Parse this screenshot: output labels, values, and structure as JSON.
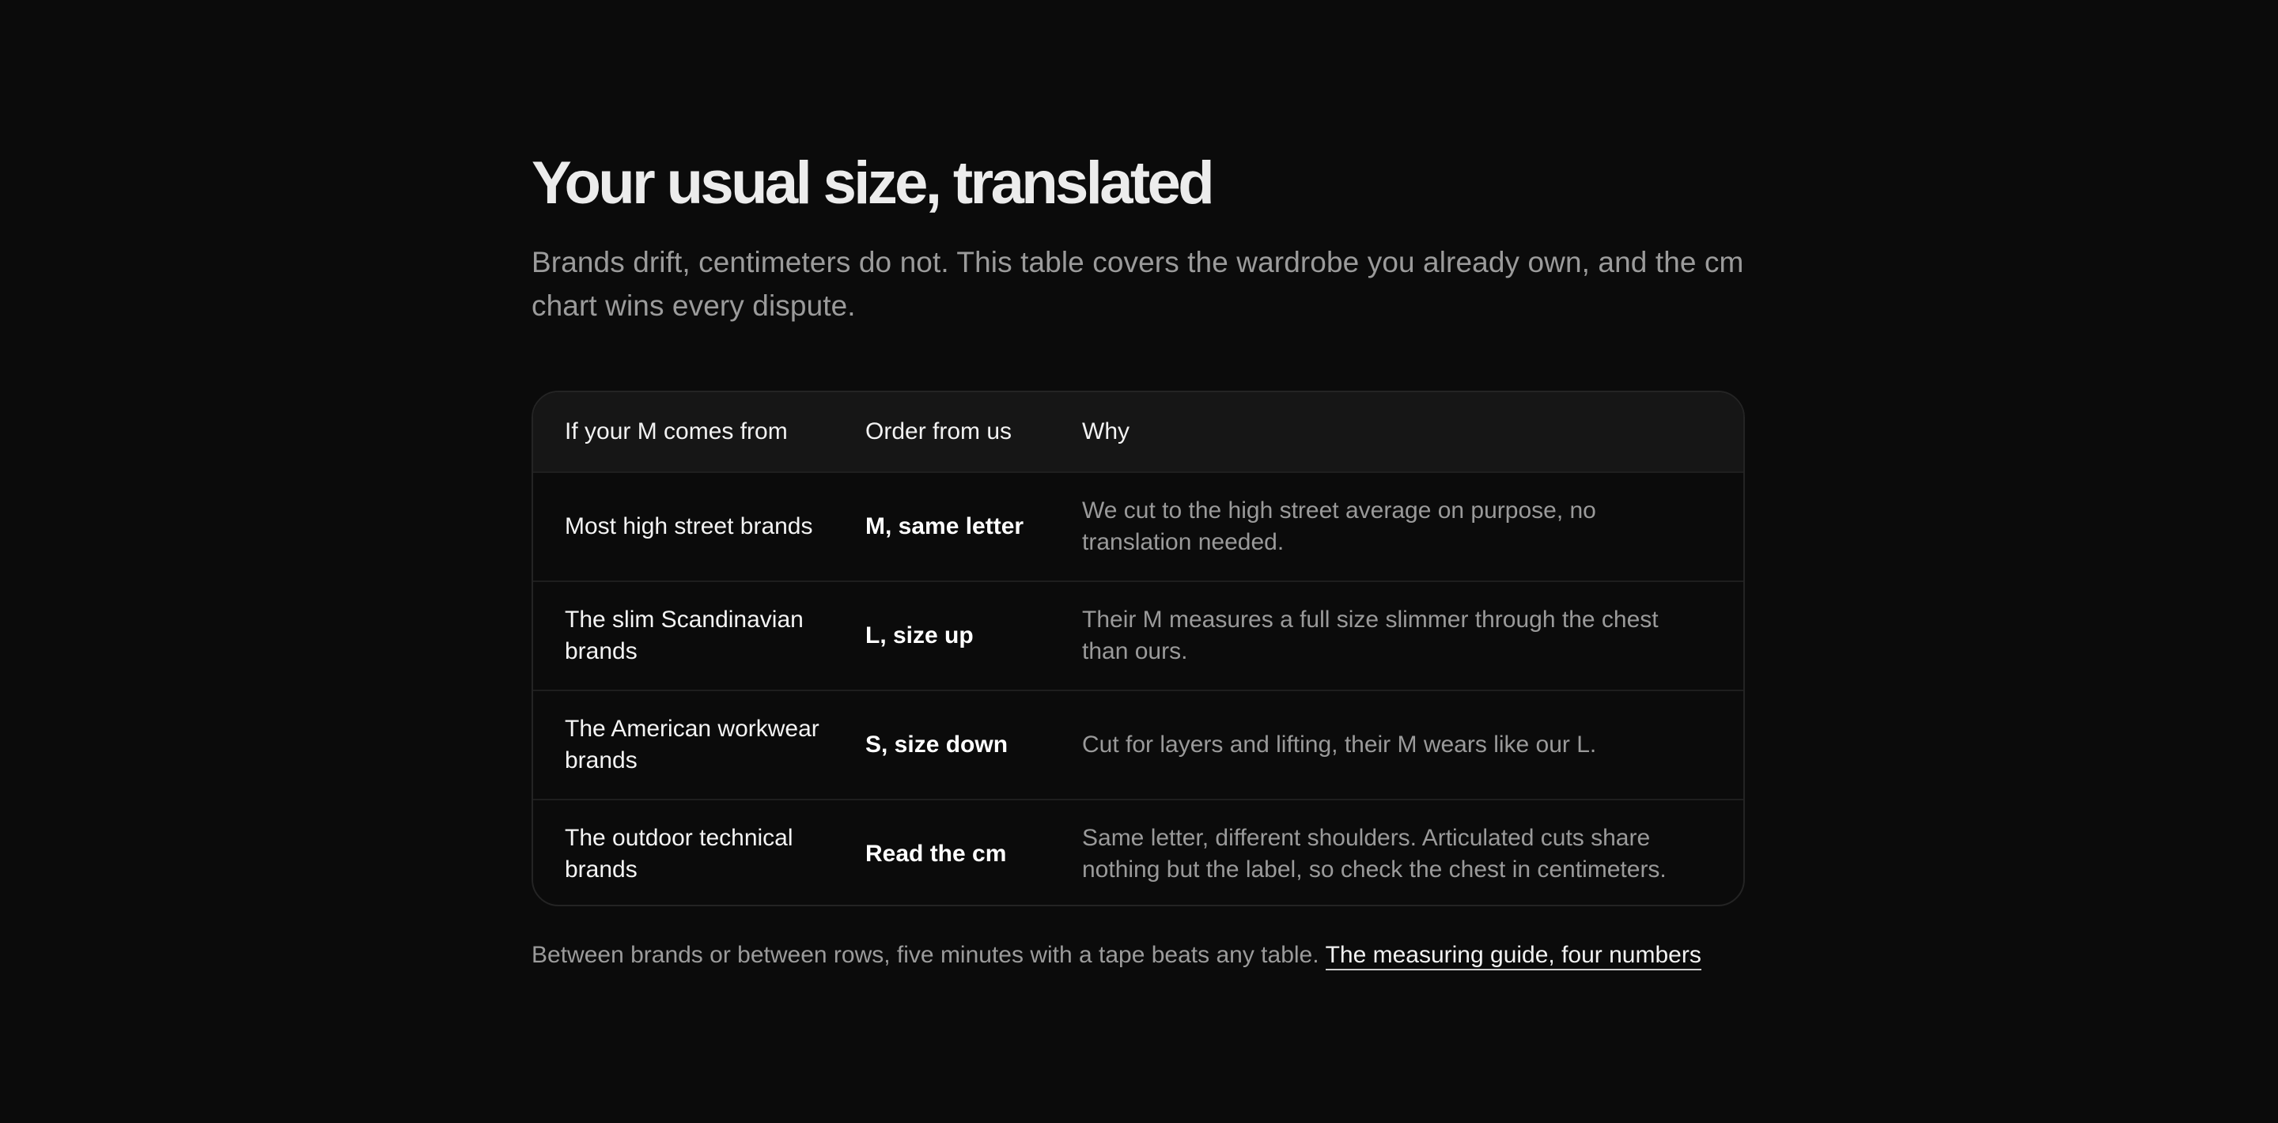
{
  "header": {
    "title": "Your usual size, translated",
    "subtitle": "Brands drift, centimeters do not. This table covers the wardrobe you already own, and the cm chart wins every dispute."
  },
  "table": {
    "columns": [
      "If your M comes from",
      "Order from us",
      "Why"
    ],
    "rows": [
      {
        "brand": "Most high street brands",
        "order": "M, same letter",
        "why": "We cut to the high street average on purpose, no translation needed."
      },
      {
        "brand": "The slim Scandinavian brands",
        "order": "L, size up",
        "why": "Their M measures a full size slimmer through the chest than ours."
      },
      {
        "brand": "The American workwear brands",
        "order": "S, size down",
        "why": "Cut for layers and lifting, their M wears like our L."
      },
      {
        "brand": "The outdoor technical brands",
        "order": "Read the cm",
        "why": "Same letter, different shoulders. Articulated cuts share nothing but the label, so check the chest in centimeters."
      }
    ]
  },
  "footer": {
    "note": "Between brands or between rows, five minutes with a tape beats any table.",
    "link_label": "The measuring guide, four numbers"
  },
  "colors": {
    "background": "#0b0b0b",
    "header_row": "#161616",
    "text_primary": "#ededed",
    "text_muted": "#9b9b9b"
  }
}
